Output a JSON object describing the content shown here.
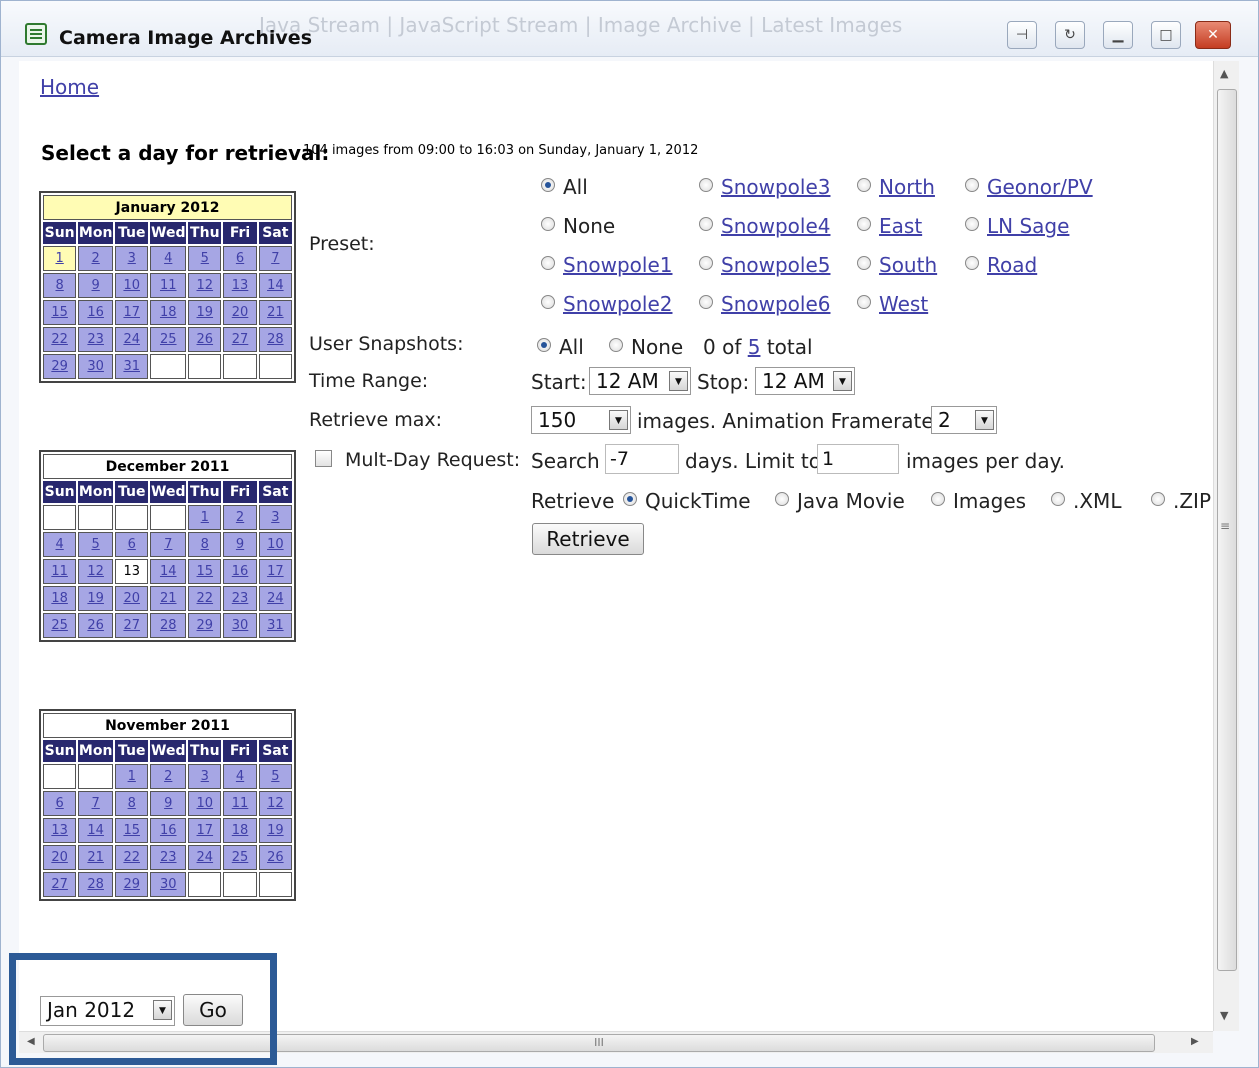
{
  "window": {
    "title": "Camera Image Archives",
    "ghost_nav": "Java Stream | JavaScript Stream | Image Archive | Latest Images"
  },
  "home_link": "Home",
  "select_label": "Select a day for retrieval:",
  "images_info": "104 images from 09:00 to 16:03 on Sunday, January 1, 2012",
  "day_names": [
    "Sun",
    "Mon",
    "Tue",
    "Wed",
    "Thu",
    "Fri",
    "Sat"
  ],
  "calendars": [
    {
      "month": "January 2012",
      "weeks": [
        [
          "1",
          "2",
          "3",
          "4",
          "5",
          "6",
          "7"
        ],
        [
          "8",
          "9",
          "10",
          "11",
          "12",
          "13",
          "14"
        ],
        [
          "15",
          "16",
          "17",
          "18",
          "19",
          "20",
          "21"
        ],
        [
          "22",
          "23",
          "24",
          "25",
          "26",
          "27",
          "28"
        ],
        [
          "29",
          "30",
          "31",
          "",
          "",
          "",
          ""
        ]
      ],
      "selected": "1"
    },
    {
      "month": "December 2011",
      "weeks": [
        [
          "",
          "",
          "",
          "",
          "1",
          "2",
          "3"
        ],
        [
          "4",
          "5",
          "6",
          "7",
          "8",
          "9",
          "10"
        ],
        [
          "11",
          "12",
          "13",
          "14",
          "15",
          "16",
          "17"
        ],
        [
          "18",
          "19",
          "20",
          "21",
          "22",
          "23",
          "24"
        ],
        [
          "25",
          "26",
          "27",
          "28",
          "29",
          "30",
          "31"
        ]
      ],
      "current": "13"
    },
    {
      "month": "November 2011",
      "weeks": [
        [
          "",
          "",
          "1",
          "2",
          "3",
          "4",
          "5"
        ],
        [
          "6",
          "7",
          "8",
          "9",
          "10",
          "11",
          "12"
        ],
        [
          "13",
          "14",
          "15",
          "16",
          "17",
          "18",
          "19"
        ],
        [
          "20",
          "21",
          "22",
          "23",
          "24",
          "25",
          "26"
        ],
        [
          "27",
          "28",
          "29",
          "30",
          "",
          "",
          ""
        ]
      ]
    }
  ],
  "preset": {
    "label": "Preset:",
    "options": [
      {
        "label": "All",
        "checked": true,
        "link": false
      },
      {
        "label": "None",
        "checked": false,
        "link": false
      },
      {
        "label": "Snowpole1",
        "checked": false,
        "link": true
      },
      {
        "label": "Snowpole2",
        "checked": false,
        "link": true
      },
      {
        "label": "Snowpole3",
        "checked": false,
        "link": true
      },
      {
        "label": "Snowpole4",
        "checked": false,
        "link": true
      },
      {
        "label": "Snowpole5",
        "checked": false,
        "link": true
      },
      {
        "label": "Snowpole6",
        "checked": false,
        "link": true
      },
      {
        "label": "North",
        "checked": false,
        "link": true
      },
      {
        "label": "East",
        "checked": false,
        "link": true
      },
      {
        "label": "South",
        "checked": false,
        "link": true
      },
      {
        "label": "West",
        "checked": false,
        "link": true
      },
      {
        "label": "Geonor/PV",
        "checked": false,
        "link": true
      },
      {
        "label": "LN Sage",
        "checked": false,
        "link": true
      },
      {
        "label": "Road",
        "checked": false,
        "link": true
      }
    ]
  },
  "snapshots": {
    "label": "User Snapshots:",
    "all": "All",
    "none": "None",
    "count_prefix": "0 of",
    "count_link": "5",
    "count_suffix": "total"
  },
  "time_range": {
    "label": "Time Range:",
    "start_label": "Start:",
    "start_value": "12 AM",
    "stop_label": "Stop:",
    "stop_value": "12 AM"
  },
  "retrieve_max": {
    "label": "Retrieve max:",
    "value": "150",
    "images_text": "images. Animation Framerate:",
    "framerate": "2"
  },
  "multiday": {
    "label": "Mult-Day Request:",
    "search_label": "Search",
    "search_value": "-7",
    "days_text": "days. Limit to",
    "limit_value": "1",
    "per_day_text": "images per day."
  },
  "retrieve_format": {
    "label": "Retrieve",
    "options": [
      {
        "label": "QuickTime",
        "checked": true
      },
      {
        "label": "Java Movie",
        "checked": false
      },
      {
        "label": "Images",
        "checked": false
      },
      {
        "label": ".XML",
        "checked": false
      },
      {
        "label": ".ZIP",
        "checked": false
      }
    ]
  },
  "retrieve_button": "Retrieve",
  "month_select": {
    "value": "Jan 2012"
  },
  "go_button": "Go",
  "scrollbar_grip": "III"
}
